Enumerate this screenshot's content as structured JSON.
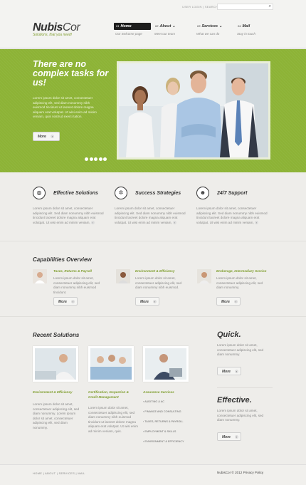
{
  "header": {
    "logo_bold": "Nubis",
    "logo_rest": "Cor",
    "tagline": "Solutions, that you need!",
    "top_links": "USER LOGIN | SEARCH",
    "search_placeholder": "",
    "nav": [
      {
        "num": "01",
        "label": "Home",
        "sub": "Our welcome page",
        "active": true
      },
      {
        "num": "02",
        "label": "About",
        "sub": "Meet our team"
      },
      {
        "num": "03",
        "label": "Services",
        "sub": "What we can do"
      },
      {
        "num": "04",
        "label": "Mail",
        "sub": "Stay in touch"
      }
    ]
  },
  "hero": {
    "title": "There are no complex tasks for us!",
    "text": "Lorem ipsum dolor sit amet, consectetuer adipiscing elit, sed diam nonummy nibh euismod tincidunt ut laoreet dolore magna aliquam erat volutpat. Ut wisi enim ad minim veniam, quis nostrud exerci tation.",
    "button": "More",
    "slides": 5
  },
  "features": [
    {
      "title": "Effective Solutions",
      "icon": "globe-icon",
      "text": "Lorem ipsum dolor sit amet, consectetuer adipiscing elit. Sed diam nonummy nibh euismod tincidunt laoreet dolore magna aliquam erat volutpat. Ut wisi enim ad minim veniam,"
    },
    {
      "title": "Success Strategies",
      "icon": "gear-icon",
      "text": "Lorem ipsum dolor sit amet, consectetuer adipiscing elit. Sed diam nonummy nibh euismod tincidunt laoreet dolore magna aliquam erat volutpat. Ut wisi enim ad minim veniam,"
    },
    {
      "title": "24/7 Support",
      "icon": "users-icon",
      "text": "Lorem ipsum dolor sit amet, consectetuer adipiscing elit. Sed diam nonummy nibh euismod tincidunt laoreet dolore magna aliquam erat volutpat. Ut wisi enim ad minim veniam,"
    }
  ],
  "capabilities": {
    "title": "Capabilities Overview",
    "items": [
      {
        "head": "Taxes, Returns & Payroll",
        "text": "Lorem ipsum dolor sit amet, consectetuer adipiscing elit, sed diam nonummy nibh euismod tincidunt.",
        "button": "More"
      },
      {
        "head": "Environment & Efficiency",
        "text": "Lorem ipsum dolor sit amet, consectetuer adipiscing elit, sed diam nonummy nibh euismod.",
        "button": "More"
      },
      {
        "head": "Brokerage, Intermediary Service",
        "text": "Lorem ipsum dolor sit amet, consectetuer adipiscing elit, sed diam nonummy.",
        "button": "More"
      }
    ]
  },
  "recent": {
    "title": "Recent Solutions",
    "col1": {
      "head": "Environment & Efficiency",
      "text": "Lorem ipsum dolor sit amet, consectetuer adipiscing elit, sed diam nonummy. Lorem ipsum dolor sit amet, consectetuer adipiscing elit, sed diam nonummy."
    },
    "col2": {
      "head": "Certification, Inspection & Credit Management",
      "text": "Lorem ipsum dolor sit amet, consectetuer adipiscing elit, sed diam nonummy nibh euismod tincidunt ut laoreet dolore magna aliquam erat volutpat. Ut wisi enim ad minim veniam, quis."
    },
    "col3": {
      "head": "Assurance Services",
      "links": [
        "AUDITING & AC",
        "FINANCE AND CONSULTING",
        "TAXES, RETURNS & PAYROLL",
        "EMPLOYMENT & SKILLS",
        "ENVIRONMENT & EFFICIENCY"
      ]
    }
  },
  "sidebar": [
    {
      "title": "Quick.",
      "text": "Lorem ipsum dolor sit amet, consectetuer adipiscing elit, sed diam nonummy.",
      "button": "More"
    },
    {
      "title": "Effective.",
      "text": "Lorem ipsum dolor sit amet, consectetuer adipiscing elit, sed diam nonummy.",
      "button": "More"
    }
  ],
  "footer": {
    "links": "HOME | ABOUT | SERVICES | MAIL",
    "copyright": "NubisCor © 2012 Privacy Policy"
  }
}
